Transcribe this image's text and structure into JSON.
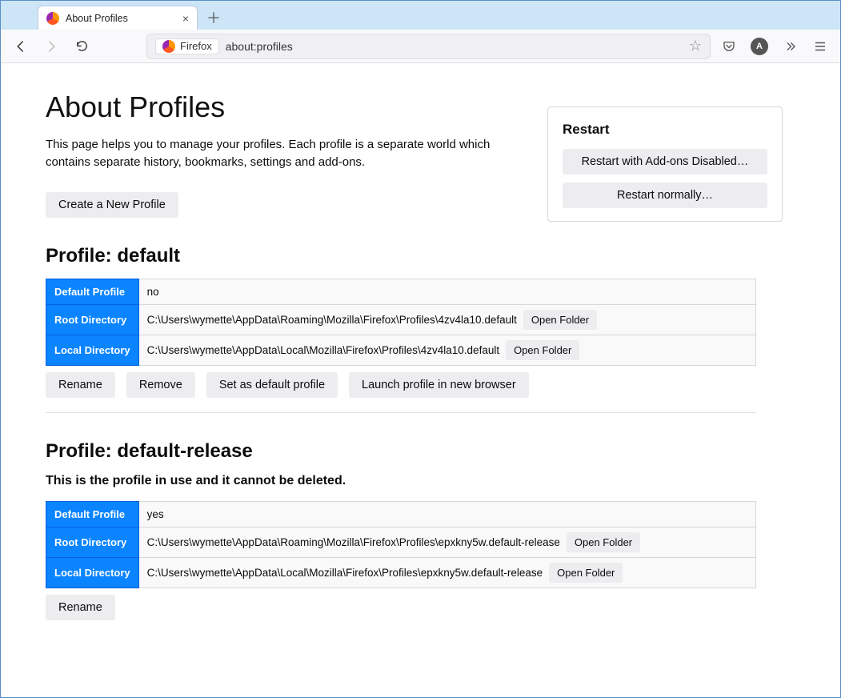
{
  "window": {
    "tab_title": "About Profiles"
  },
  "url_bar": {
    "identity_label": "Firefox",
    "url": "about:profiles"
  },
  "toolbar": {
    "avatar_letter": "A"
  },
  "page": {
    "title": "About Profiles",
    "intro": "This page helps you to manage your profiles. Each profile is a separate world which contains separate history, bookmarks, settings and add-ons.",
    "create_button": "Create a New Profile"
  },
  "restart": {
    "heading": "Restart",
    "addons_disabled": "Restart with Add-ons Disabled…",
    "normally": "Restart normally…"
  },
  "labels": {
    "default_profile": "Default Profile",
    "root_directory": "Root Directory",
    "local_directory": "Local Directory",
    "open_folder": "Open Folder",
    "rename": "Rename",
    "remove": "Remove",
    "set_default": "Set as default profile",
    "launch": "Launch profile in new browser"
  },
  "profiles": [
    {
      "heading": "Profile: default",
      "in_use": false,
      "default_value": "no",
      "root_path": "C:\\Users\\wymette\\AppData\\Roaming\\Mozilla\\Firefox\\Profiles\\4zv4la10.default",
      "local_path": "C:\\Users\\wymette\\AppData\\Local\\Mozilla\\Firefox\\Profiles\\4zv4la10.default",
      "actions": [
        "rename",
        "remove",
        "set_default",
        "launch"
      ]
    },
    {
      "heading": "Profile: default-release",
      "in_use": true,
      "in_use_text": "This is the profile in use and it cannot be deleted.",
      "default_value": "yes",
      "root_path": "C:\\Users\\wymette\\AppData\\Roaming\\Mozilla\\Firefox\\Profiles\\epxkny5w.default-release",
      "local_path": "C:\\Users\\wymette\\AppData\\Local\\Mozilla\\Firefox\\Profiles\\epxkny5w.default-release",
      "actions": [
        "rename"
      ]
    }
  ]
}
